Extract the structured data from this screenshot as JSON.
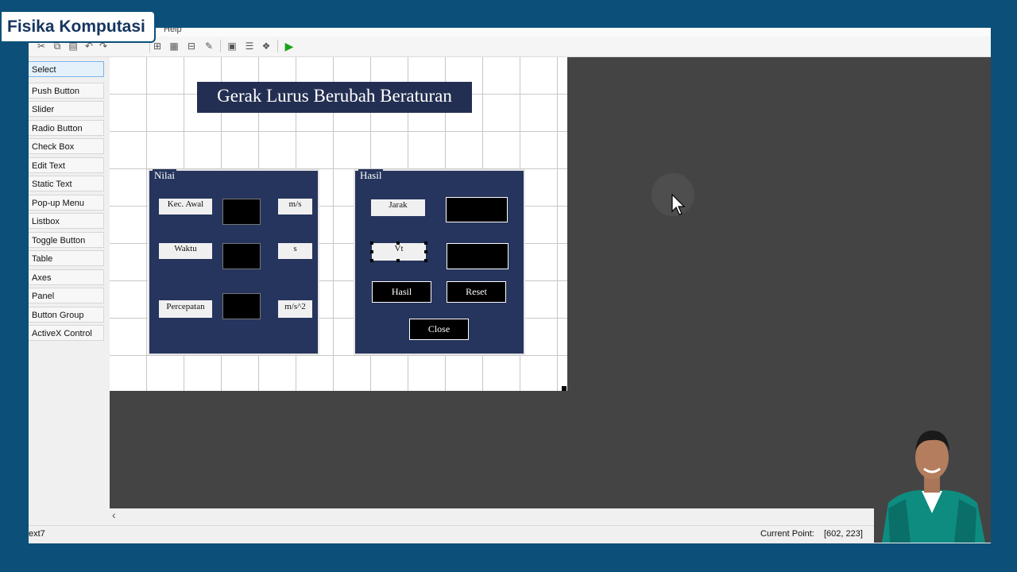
{
  "brand": {
    "label": "Fisika Komputasi"
  },
  "menubar": {
    "help_label": "Help"
  },
  "toolbar": {
    "icons": [
      "align-icon",
      "menu-editor-icon",
      "tab-order-icon",
      "toolbar-editor-icon",
      "mfile-editor-icon",
      "property-inspector-icon",
      "object-browser-icon",
      "run-icon"
    ]
  },
  "palette": {
    "items": [
      {
        "label": "Select"
      },
      {
        "label": "Push Button"
      },
      {
        "label": "Slider"
      },
      {
        "label": "Radio Button"
      },
      {
        "label": "Check Box"
      },
      {
        "label": "Edit Text"
      },
      {
        "label": "Static Text"
      },
      {
        "label": "Pop-up Menu"
      },
      {
        "label": "Listbox"
      },
      {
        "label": "Toggle Button"
      },
      {
        "label": "Table"
      },
      {
        "label": "Axes"
      },
      {
        "label": "Panel"
      },
      {
        "label": "Button Group"
      },
      {
        "label": "ActiveX Control"
      }
    ]
  },
  "figure": {
    "title": "Gerak Lurus Berubah Beraturan",
    "panel_nilai": {
      "title": "Nilai",
      "label_kec_awal": "Kec. Awal",
      "unit_kec_awal": "m/s",
      "label_waktu": "Waktu",
      "unit_waktu": "s",
      "label_percepatan": "Percepatan",
      "unit_percepatan": "m/s^2"
    },
    "panel_hasil": {
      "title": "Hasil",
      "label_jarak": "Jarak",
      "label_vt": "Vt",
      "button_hasil": "Hasil",
      "button_reset": "Reset",
      "button_close": "Close"
    }
  },
  "statusbar": {
    "left_text": "ext7",
    "current_point_label": "Current Point:",
    "current_point_value": "[602, 223]"
  },
  "colors": {
    "background": "#0c5079",
    "canvas": "#444444",
    "panel": "#26355d",
    "title_bar": "#232f52"
  }
}
